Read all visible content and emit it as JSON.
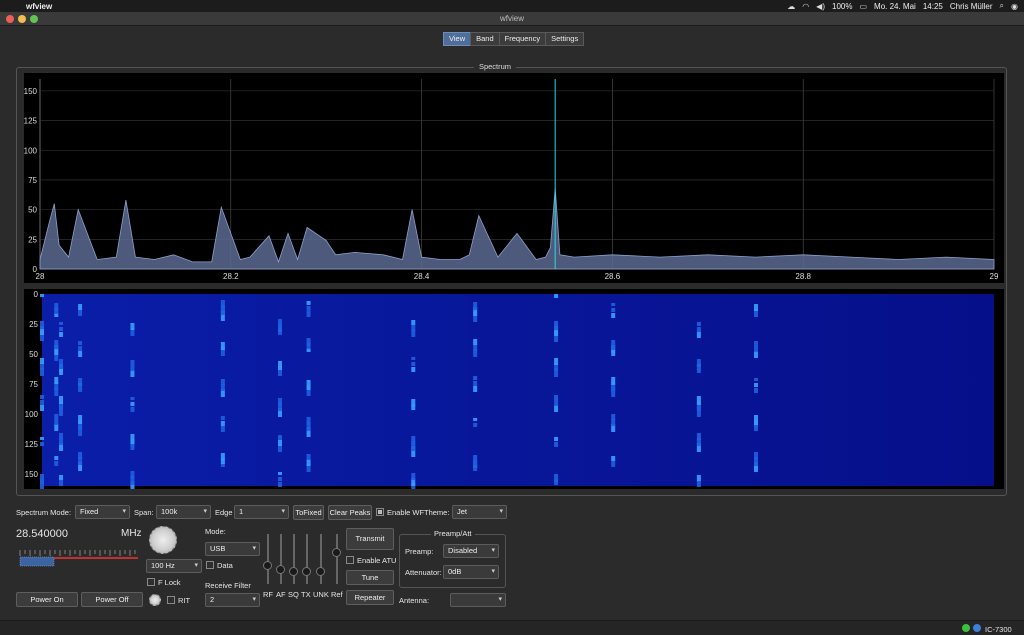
{
  "menubar": {
    "app_name": "wfview",
    "date": "Mo. 24. Mai",
    "time": "14:25",
    "user": "Chris Müller",
    "battery": "100%"
  },
  "window": {
    "title": "wfview"
  },
  "tabs": [
    {
      "label": "View",
      "active": true
    },
    {
      "label": "Band",
      "active": false
    },
    {
      "label": "Frequency",
      "active": false
    },
    {
      "label": "Settings",
      "active": false
    }
  ],
  "spectrum_group": {
    "title": "Spectrum"
  },
  "chart_data": [
    {
      "type": "area",
      "x_ticks": [
        "28",
        "28.2",
        "28.4",
        "28.6",
        "28.8",
        "29"
      ],
      "y_ticks": [
        "0",
        "25",
        "50",
        "75",
        "100",
        "125",
        "150"
      ],
      "xlim": [
        28.0,
        29.0
      ],
      "ylim": [
        0,
        160
      ],
      "grid": true,
      "series": [
        {
          "x": [
            28.0,
            28.01,
            28.015,
            28.02,
            28.03,
            28.04,
            28.06,
            28.08,
            28.09,
            28.1,
            28.12,
            28.14,
            28.16,
            28.18,
            28.19,
            28.21,
            28.22,
            28.24,
            28.25,
            28.26,
            28.27,
            28.28,
            28.3,
            28.31,
            28.33,
            28.36,
            28.38,
            28.39,
            28.4,
            28.42,
            28.44,
            28.45,
            28.46,
            28.48,
            28.5,
            28.52,
            28.53,
            28.535,
            28.54,
            28.545,
            28.56,
            28.6,
            28.65,
            28.7,
            28.75,
            28.8,
            28.85,
            28.9,
            28.95,
            29.0
          ],
          "values": [
            8,
            40,
            55,
            20,
            10,
            50,
            8,
            10,
            58,
            10,
            8,
            12,
            6,
            6,
            52,
            8,
            10,
            28,
            6,
            30,
            8,
            35,
            24,
            12,
            14,
            12,
            8,
            50,
            10,
            8,
            8,
            12,
            45,
            10,
            30,
            8,
            10,
            18,
            68,
            12,
            10,
            12,
            10,
            12,
            10,
            12,
            10,
            8,
            10,
            8
          ]
        }
      ],
      "peak_marker_x": 28.54
    },
    {
      "type": "heatmap",
      "colormap": "Jet",
      "y_ticks": [
        "0",
        "25",
        "50",
        "75",
        "100",
        "125",
        "150"
      ],
      "ylim": [
        0,
        160
      ],
      "xlim": [
        28.0,
        29.0
      ],
      "signal_columns_x": [
        28.0,
        28.015,
        28.02,
        28.04,
        28.095,
        28.19,
        28.25,
        28.28,
        28.39,
        28.455,
        28.54,
        28.6,
        28.69,
        28.75
      ]
    }
  ],
  "controls": {
    "spectrum_mode_label": "Spectrum Mode:",
    "spectrum_mode_value": "Fixed",
    "span_label": "Span:",
    "span_value": "100k",
    "edge_label": "Edge",
    "edge_value": "1",
    "tofixed_label": "ToFixed",
    "clear_peaks_label": "Clear Peaks",
    "enable_wf_label": "Enable WF",
    "enable_wf_checked": true,
    "theme_label": "Theme:",
    "theme_value": "Jet",
    "frequency": "28.540000",
    "frequency_unit": "MHz",
    "tuning_step_value": "100 Hz",
    "flock_label": "F Lock",
    "rit_label": "RIT",
    "power_on_label": "Power On",
    "power_off_label": "Power Off",
    "mode_label": "Mode:",
    "mode_value": "USB",
    "data_label": "Data",
    "receive_filter_label": "Receive Filter",
    "receive_filter_value": "2",
    "sliders": [
      "RF",
      "AF",
      "SQ",
      "TX",
      "UNK",
      "Ref"
    ],
    "transmit_label": "Transmit",
    "enable_atu_label": "Enable ATU",
    "tune_label": "Tune",
    "repeater_label": "Repeater",
    "preamp_group_title": "Preamp/Att",
    "preamp_label": "Preamp:",
    "preamp_value": "Disabled",
    "attenuator_label": "Attenuator:",
    "attenuator_value": "0dB",
    "antenna_label": "Antenna:",
    "antenna_value": ""
  },
  "status": {
    "radio": "IC-7300"
  }
}
